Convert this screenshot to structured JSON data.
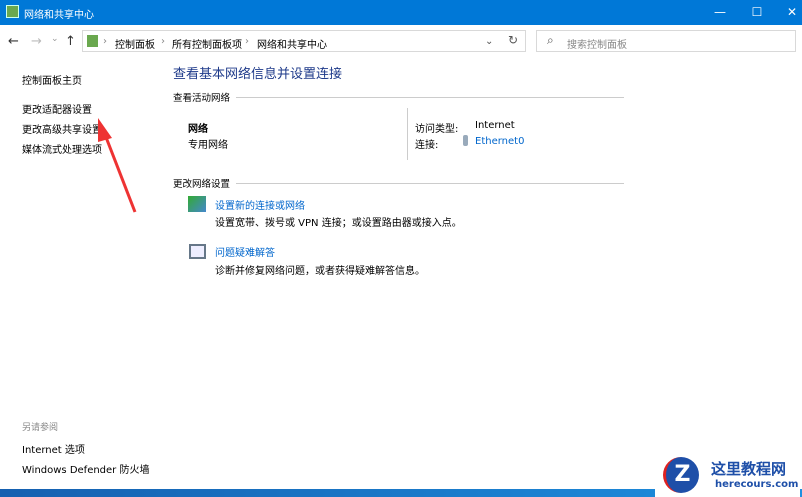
{
  "window": {
    "title": "网络和共享中心",
    "minimize": "—",
    "maximize": "☐",
    "close": "✕"
  },
  "address": {
    "back": "←",
    "forward": "→",
    "recent": "⌄",
    "up": "↑",
    "crumbs": [
      "控制面板",
      "所有控制面板项",
      "网络和共享中心"
    ],
    "dropdown": "⌄",
    "refresh": "↻",
    "search_placeholder": "搜索控制面板"
  },
  "sidebar": {
    "home": "控制面板主页",
    "items": [
      "更改适配器设置",
      "更改高级共享设置",
      "媒体流式处理选项"
    ],
    "see_also": "另请参阅",
    "see_also_items": [
      "Internet 选项",
      "Windows Defender 防火墙"
    ]
  },
  "main": {
    "title": "查看基本网络信息并设置连接",
    "active_section": "查看活动网络",
    "network_name": "网络",
    "network_type": "专用网络",
    "access_label": "访问类型:",
    "access_value": "Internet",
    "conn_label": "连接:",
    "conn_value": "Ethernet0",
    "change_section": "更改网络设置",
    "tasks": [
      {
        "title": "设置新的连接或网络",
        "desc": "设置宽带、拨号或 VPN 连接；或设置路由器或接入点。"
      },
      {
        "title": "问题疑难解答",
        "desc": "诊断并修复网络问题，或者获得疑难解答信息。"
      }
    ]
  },
  "watermark": {
    "name": "这里教程网",
    "url": "herecours.com"
  }
}
